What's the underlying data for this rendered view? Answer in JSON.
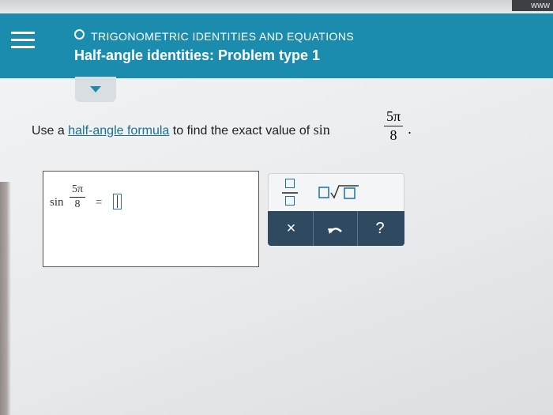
{
  "browser": {
    "corner_tag": "www"
  },
  "header": {
    "topic": "TRIGONOMETRIC IDENTITIES AND EQUATIONS",
    "title": "Half-angle identities: Problem type 1",
    "menu_icon": "hamburger-menu-icon",
    "topic_icon": "circle-outline-icon",
    "color": "#1c8cae"
  },
  "question": {
    "prefix": "Use a",
    "link": "half-angle formula",
    "suffix": "to find the exact value of",
    "function": "sin",
    "numerator": "5π",
    "denominator": "8",
    "end": "."
  },
  "answer": {
    "function": "sin",
    "numerator": "5π",
    "denominator": "8",
    "equals": "=",
    "value": ""
  },
  "keypad": {
    "fraction_icon": "fraction-template-icon",
    "sqrt_icon": "square-root-template-icon",
    "clear_label": "×",
    "undo_icon": "undo-arrow-icon",
    "help_label": "?",
    "bar_color": "#2f4a60"
  }
}
